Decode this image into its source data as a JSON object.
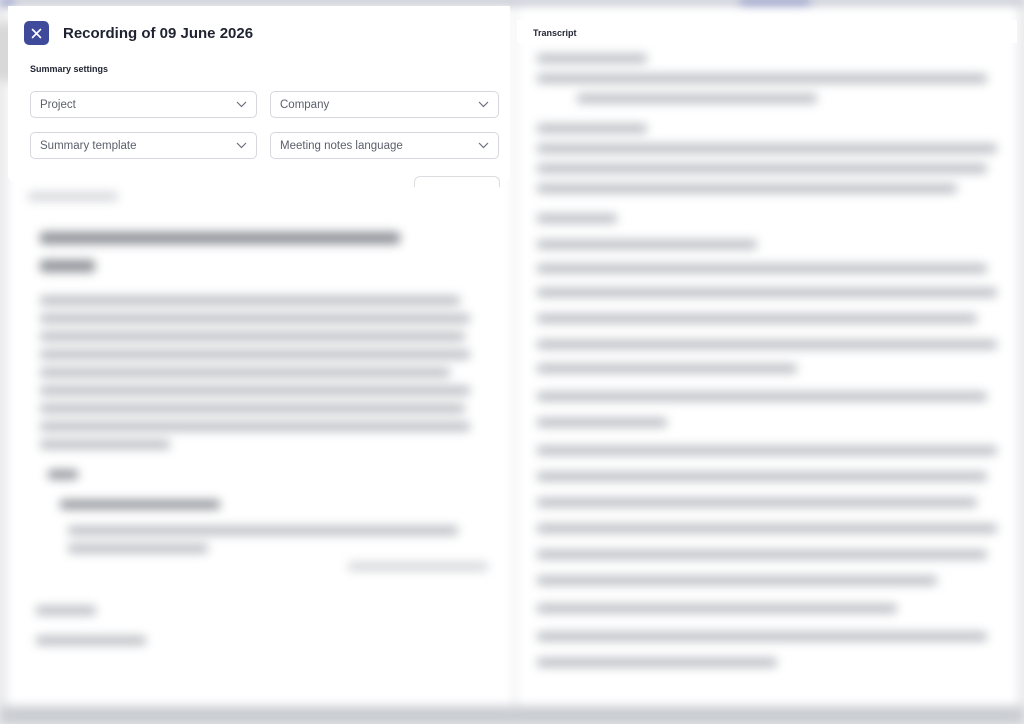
{
  "modal": {
    "title": "Recording of 09 June 2026",
    "section_label": "Summary settings",
    "fields": {
      "project": {
        "placeholder": "Project"
      },
      "company": {
        "placeholder": "Company"
      },
      "summary_template": {
        "placeholder": "Summary template"
      },
      "meeting_notes_language": {
        "placeholder": "Meeting notes language"
      }
    }
  },
  "transcript": {
    "label": "Transcript"
  },
  "colors": {
    "accent": "#3f4a9a",
    "border": "#d6d8dd"
  },
  "icons": {
    "close": "close-icon",
    "dropdown": "chevron-down-icon"
  }
}
